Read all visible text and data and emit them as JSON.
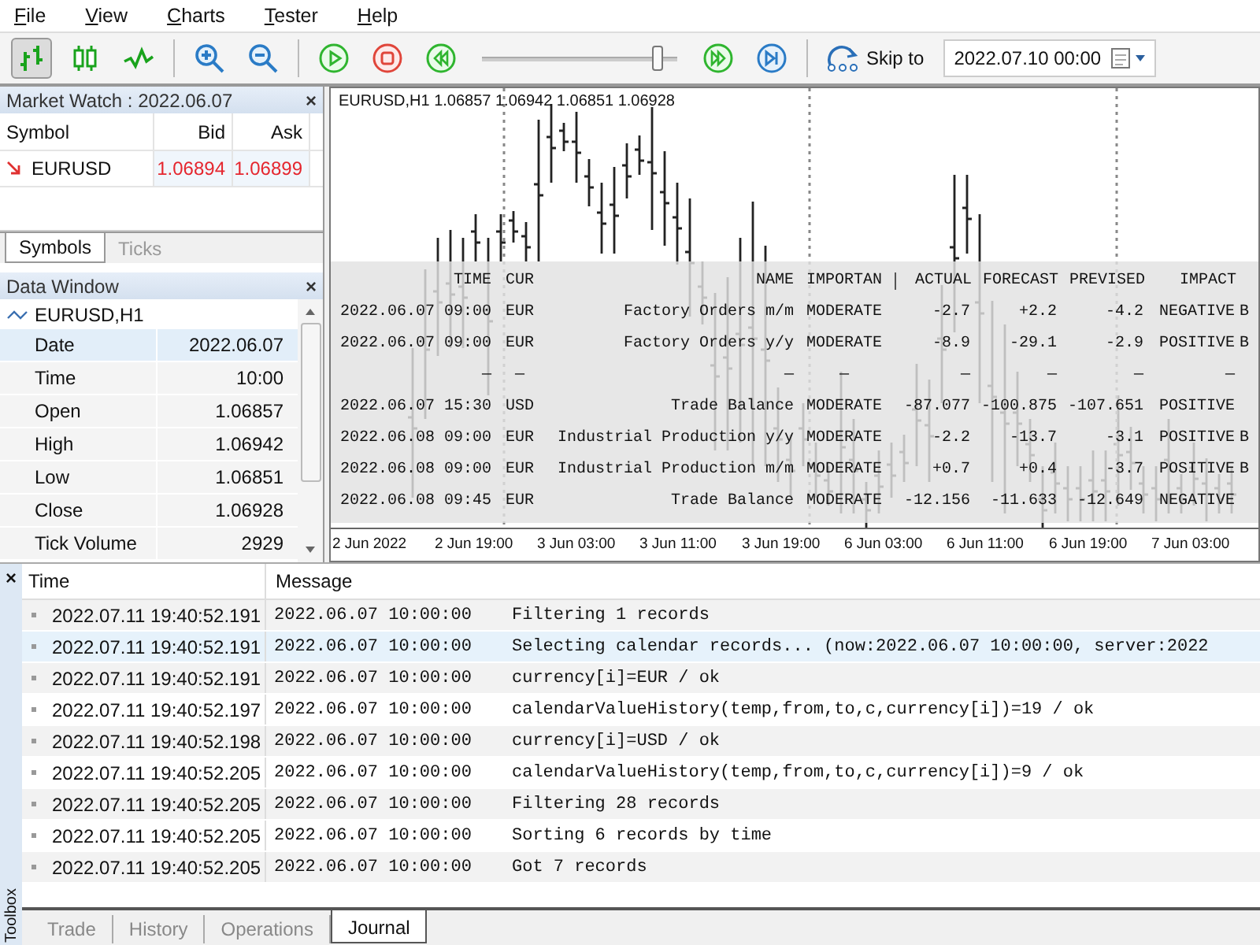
{
  "menu": [
    "File",
    "View",
    "Charts",
    "Tester",
    "Help"
  ],
  "toolbar": {
    "chart_types": [
      {
        "kind": "bars",
        "selected": true
      },
      {
        "kind": "candles",
        "selected": false
      },
      {
        "kind": "line",
        "selected": false
      }
    ],
    "speed_slider": {
      "level": 0.93
    },
    "skip_to": {
      "label": "Skip to",
      "value": "2022.07.10 00:00"
    }
  },
  "market_watch": {
    "title": "Market Watch : 2022.06.07",
    "close": "×",
    "columns": [
      "Symbol",
      "Bid",
      "Ask"
    ],
    "rows": [
      {
        "symbol": "EURUSD",
        "bid": "1.06894",
        "ask": "1.06899"
      }
    ],
    "tabs": [
      {
        "label": "Symbols",
        "selected": true
      },
      {
        "label": "Ticks",
        "selected": false
      }
    ]
  },
  "data_window": {
    "title": "Data Window",
    "close": "×",
    "series": "EURUSD,H1",
    "rows": [
      {
        "label": "Date",
        "value": "2022.06.07",
        "selected": true
      },
      {
        "label": "Time",
        "value": "10:00",
        "selected": false
      },
      {
        "label": "Open",
        "value": "1.06857",
        "selected": false
      },
      {
        "label": "High",
        "value": "1.06942",
        "selected": false
      },
      {
        "label": "Low",
        "value": "1.06851",
        "selected": false
      },
      {
        "label": "Close",
        "value": "1.06928",
        "selected": false
      },
      {
        "label": "Tick Volume",
        "value": "2929",
        "selected": false
      }
    ]
  },
  "chart": {
    "header": "EURUSD,H1  1.06857 1.06942 1.06851 1.06928",
    "calendar": {
      "columns": [
        "TIME",
        "CUR",
        "NAME",
        "IMPORTAN",
        "ACTUAL",
        "FORECAST",
        "PREVISED",
        "IMPACT"
      ],
      "rows": [
        [
          "2022.06.07 09:00",
          "EUR",
          "Factory Orders m/m",
          "MODERATE",
          "-2.7",
          "+2.2",
          "-4.2",
          "NEGATIVE",
          "B"
        ],
        [
          "2022.06.07 09:00",
          "EUR",
          "Factory Orders y/y",
          "MODERATE",
          "-8.9",
          "-29.1",
          "-2.9",
          "POSITIVE",
          "B"
        ],
        [
          "—",
          "—",
          "—",
          "—",
          "—",
          "—",
          "—",
          "—"
        ],
        [
          "2022.06.07 15:30",
          "USD",
          "Trade Balance",
          "MODERATE",
          "-87.077",
          "-100.875",
          "-107.651",
          "POSITIVE"
        ],
        [
          "2022.06.08 09:00",
          "EUR",
          "Industrial Production y/y",
          "MODERATE",
          "-2.2",
          "-13.7",
          "-3.1",
          "POSITIVE",
          "B"
        ],
        [
          "2022.06.08 09:00",
          "EUR",
          "Industrial Production m/m",
          "MODERATE",
          "+0.7",
          "+0.4",
          "-3.7",
          "POSITIVE",
          "B"
        ],
        [
          "2022.06.08 09:45",
          "EUR",
          "Trade Balance",
          "MODERATE",
          "-12.156",
          "-11.633",
          "-12.649",
          "NEGATIVE"
        ]
      ]
    },
    "x_axis": [
      "2 Jun 2022",
      "2 Jun 19:00",
      "3 Jun 03:00",
      "3 Jun 11:00",
      "3 Jun 19:00",
      "6 Jun 03:00",
      "6 Jun 11:00",
      "6 Jun 19:00",
      "7 Jun 03:00"
    ]
  },
  "toolbox": {
    "close": "×",
    "label": "Toolbox",
    "columns": [
      "Time",
      "Message"
    ],
    "rows": [
      {
        "time": "2022.07.11 19:40:52.191",
        "date": "2022.06.07 10:00:00",
        "message": "Filtering 1 records",
        "selected": false
      },
      {
        "time": "2022.07.11 19:40:52.191",
        "date": "2022.06.07 10:00:00",
        "message": "Selecting calendar records... (now:2022.06.07 10:00:00, server:2022",
        "selected": true
      },
      {
        "time": "2022.07.11 19:40:52.191",
        "date": "2022.06.07 10:00:00",
        "message": "currency[i]=EUR / ok",
        "selected": false
      },
      {
        "time": "2022.07.11 19:40:52.197",
        "date": "2022.06.07 10:00:00",
        "message": "calendarValueHistory(temp,from,to,c,currency[i])=19 / ok",
        "selected": false
      },
      {
        "time": "2022.07.11 19:40:52.198",
        "date": "2022.06.07 10:00:00",
        "message": "currency[i]=USD / ok",
        "selected": false
      },
      {
        "time": "2022.07.11 19:40:52.205",
        "date": "2022.06.07 10:00:00",
        "message": "calendarValueHistory(temp,from,to,c,currency[i])=9 / ok",
        "selected": false
      },
      {
        "time": "2022.07.11 19:40:52.205",
        "date": "2022.06.07 10:00:00",
        "message": "Filtering 28 records",
        "selected": false
      },
      {
        "time": "2022.07.11 19:40:52.205",
        "date": "2022.06.07 10:00:00",
        "message": "Sorting 6 records by time",
        "selected": false
      },
      {
        "time": "2022.07.11 19:40:52.205",
        "date": "2022.06.07 10:00:00",
        "message": "Got 7 records",
        "selected": false
      }
    ],
    "tabs": [
      {
        "label": "Trade",
        "selected": false
      },
      {
        "label": "History",
        "selected": false
      },
      {
        "label": "Operations",
        "selected": false
      },
      {
        "label": "Journal",
        "selected": true
      }
    ]
  }
}
